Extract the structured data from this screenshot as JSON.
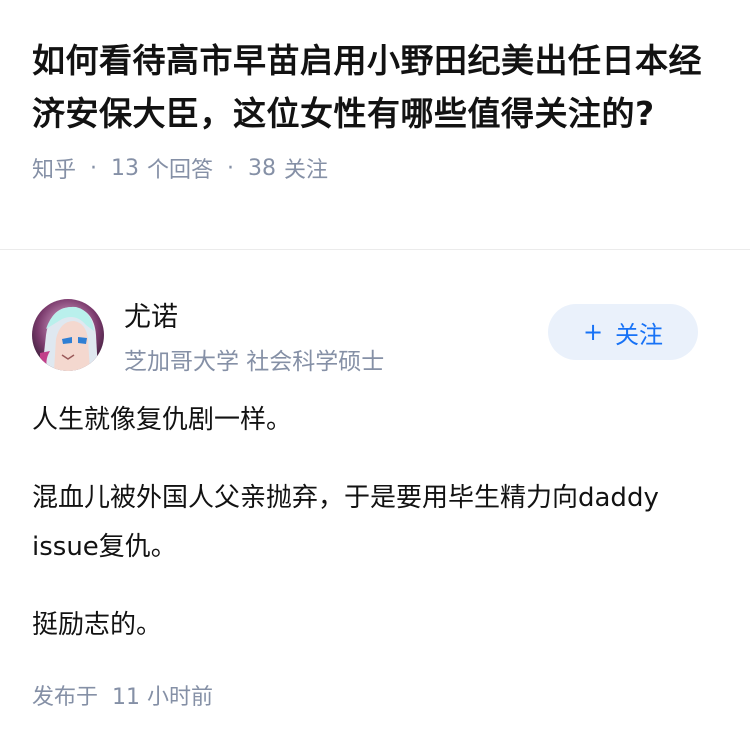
{
  "question": {
    "title": "如何看待高市早苗启用小野田纪美出任日本经济安保大臣，这位女性有哪些值得关注的?",
    "source": "知乎",
    "answer_count": "13",
    "answer_label": "个回答",
    "follow_count": "38",
    "follow_label": "关注"
  },
  "answer": {
    "author": {
      "name": "尤诺",
      "description": "芝加哥大学 社会科学硕士",
      "avatar_icon": "anime-avatar-icon"
    },
    "follow_button": {
      "plus": "+",
      "label": "关注"
    },
    "paragraphs": [
      "人生就像复仇剧一样。",
      "混血儿被外国人父亲抛弃，于是要用毕生精力向daddy issue复仇。",
      "挺励志的。"
    ],
    "published_label": "发布于",
    "published_time": "11 小时前"
  },
  "colors": {
    "meta_gray": "#8590a6",
    "accent_blue": "#1772f6",
    "button_bg": "#eaf1fb"
  }
}
